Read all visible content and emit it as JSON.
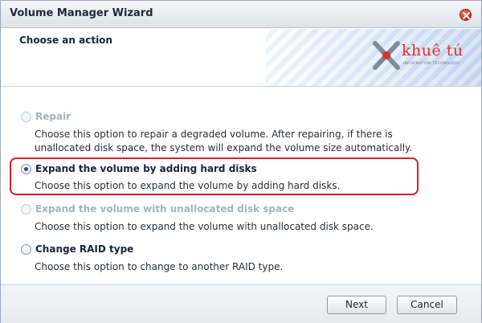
{
  "window": {
    "title": "Volume Manager Wizard",
    "close_icon": "close-icon"
  },
  "header": {
    "title": "Choose an action",
    "logo_text": "khuê tú",
    "logo_subtitle": "INFORMATION TECHNOLOGY"
  },
  "options": [
    {
      "label": "Repair",
      "description": "Choose this option to repair a degraded volume. After repairing, if there is unallocated disk space, the system will expand the volume size automatically.",
      "enabled": false,
      "selected": false
    },
    {
      "label": "Expand the volume by adding hard disks",
      "description": "Choose this option to expand the volume by adding hard disks.",
      "enabled": true,
      "selected": true,
      "highlighted": true
    },
    {
      "label": "Expand the volume with unallocated disk space",
      "description": "Choose this option to expand the volume with unallocated disk space.",
      "enabled": false,
      "selected": false
    },
    {
      "label": "Change RAID type",
      "description": "Choose this option to change to another RAID type.",
      "enabled": true,
      "selected": false
    }
  ],
  "footer": {
    "next_label": "Next",
    "cancel_label": "Cancel"
  },
  "colors": {
    "highlight_border": "#d81e29",
    "logo_red": "#d9342b"
  }
}
